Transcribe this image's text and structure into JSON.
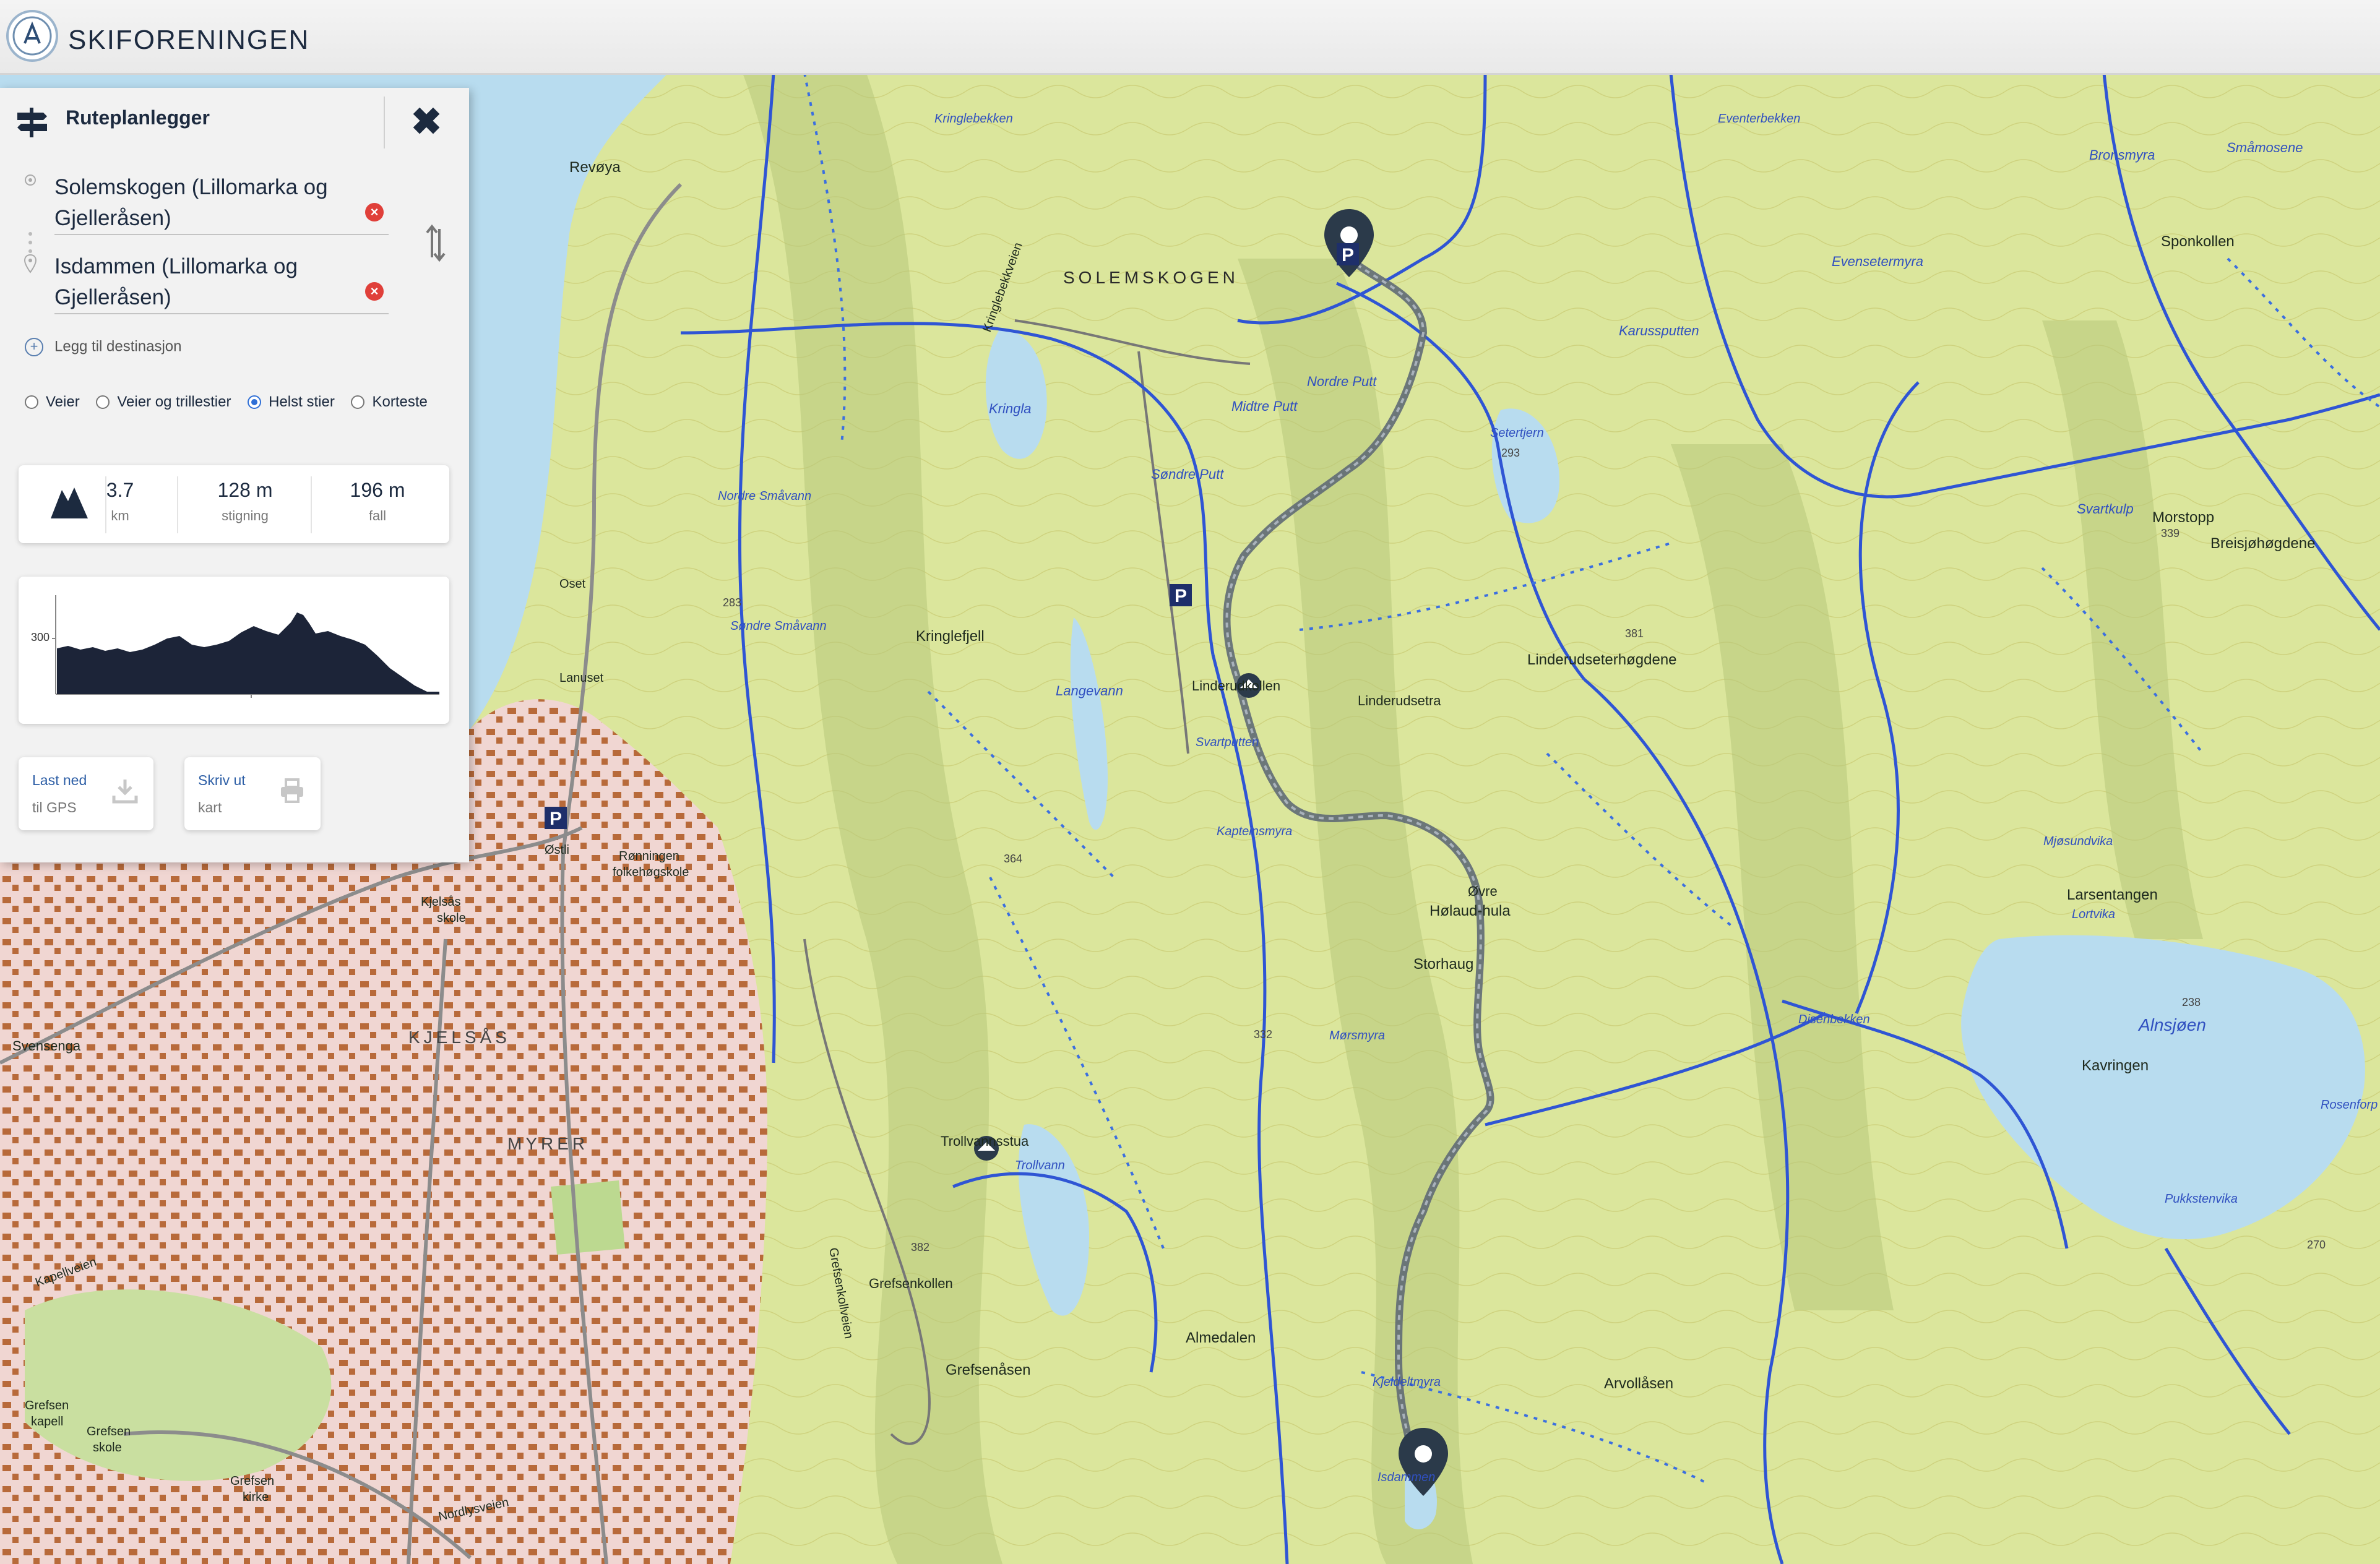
{
  "header": {
    "brand": "SKIFORENINGEN"
  },
  "panel": {
    "title": "Ruteplanlegger",
    "close_icon": "close-icon",
    "from": "Solemskogen (Lillomarka og Gjelleråsen)",
    "to": "Isdammen (Lillomarka og Gjelleråsen)",
    "add_destination": "Legg til destinasjon",
    "route_options": [
      {
        "label": "Veier",
        "selected": false
      },
      {
        "label": "Veier og trillestier",
        "selected": false
      },
      {
        "label": "Helst stier",
        "selected": true
      },
      {
        "label": "Korteste",
        "selected": false
      }
    ],
    "stats": {
      "distance_value": "3.7",
      "distance_unit": "km",
      "ascent_value": "128 m",
      "ascent_unit": "stigning",
      "descent_value": "196 m",
      "descent_unit": "fall"
    },
    "profile": {
      "y_tick": "300"
    },
    "download": {
      "line1": "Last ned",
      "line2": "til GPS"
    },
    "print": {
      "line1": "Skriv ut",
      "line2": "kart"
    }
  },
  "map": {
    "place_labels": [
      "Revøya",
      "SOLEMSKOGEN",
      "Kringlebekken",
      "Kringla",
      "Midtre Putt",
      "Nordre Putt",
      "Søndre Putt",
      "Karussputten",
      "Evensetermyra",
      "Eventerbekken",
      "Bronsmyra",
      "Småmosene",
      "Sponkollen",
      "Setertjern",
      "Svartkulp",
      "Morstopp",
      "Breisjøhøgdene",
      "Nordre Småvann",
      "Søndre Småvann",
      "Kringlefjell",
      "Langevann",
      "Linderudkollen",
      "Linderudsetra",
      "Linderudseterhøgdene",
      "Svartputten",
      "Kapteinsmyra",
      "Øvre Hølaud-hula",
      "Storhaug",
      "Mørsmyra",
      "Mjøsundvika",
      "Larsentangen",
      "Lortvika",
      "Alnsjøen",
      "Kavringen",
      "Disenbekken",
      "Rosenforp",
      "Pukkstenvika",
      "Trollvannsstua",
      "Trollvann",
      "Grefsenkollen",
      "Grefsenåsen",
      "Almedalen",
      "Arvollåsen",
      "Kjeldeltmyra",
      "Isdammen",
      "KJELSÅS",
      "MYRER",
      "Rønningen folkehøgskole",
      "Kjelsås skole",
      "Grefsen kapell",
      "Grefsen skole",
      "Grefsen kirke",
      "Kapellveien",
      "Nordlysveien",
      "Svensenga",
      "Oset",
      "Lanuset",
      "Østli",
      "Grefsenkollveien",
      "Kringlebekkveien"
    ],
    "elevations": [
      "293",
      "283",
      "381",
      "364",
      "332",
      "238",
      "270",
      "382",
      "339"
    ],
    "start_marker": "Solemskogen",
    "end_marker": "Isdammen"
  }
}
